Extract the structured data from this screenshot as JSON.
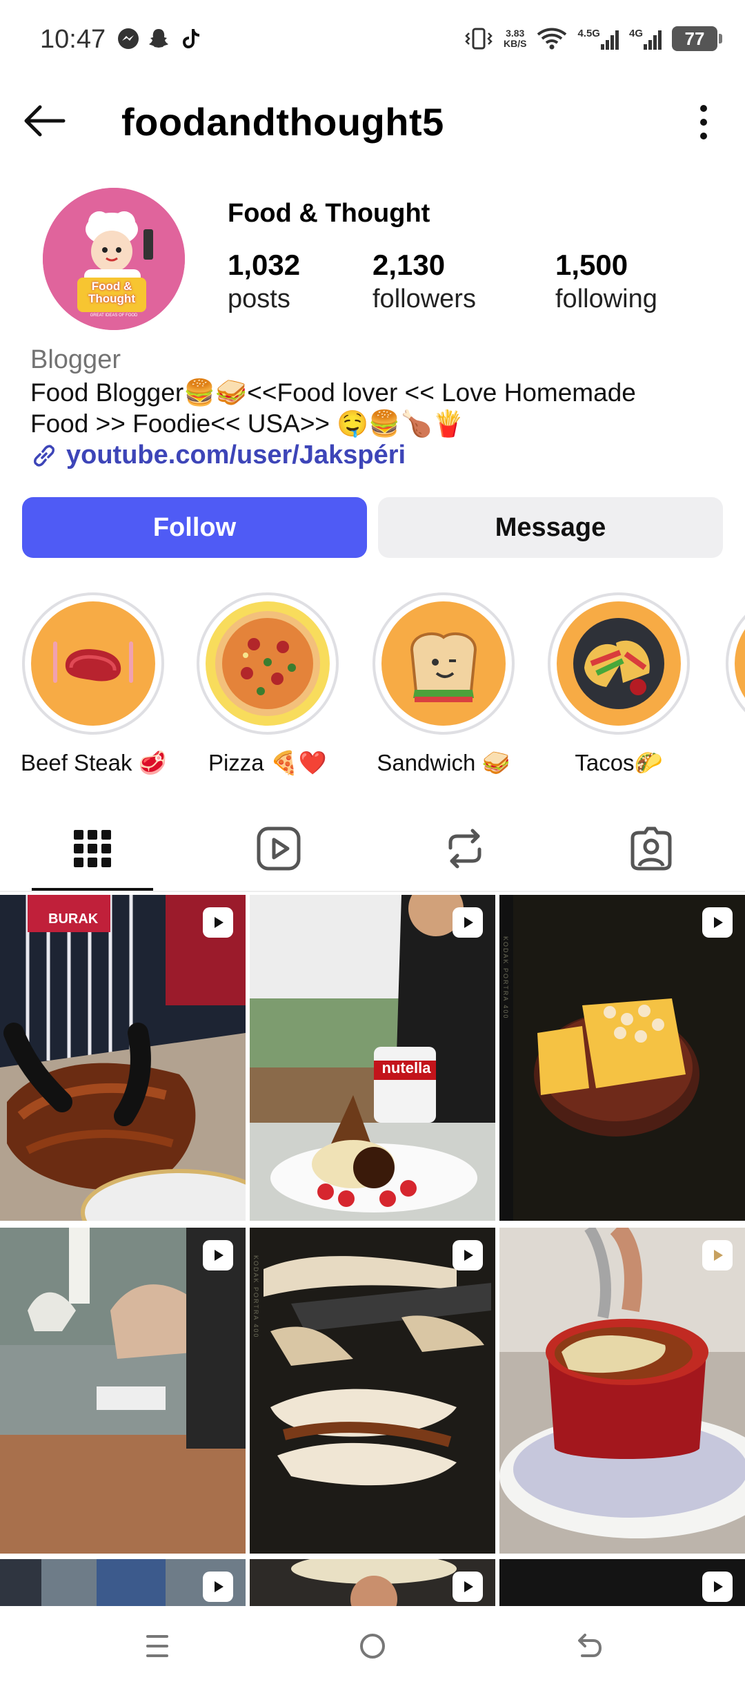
{
  "status_bar": {
    "time": "10:47",
    "speed_value": "3.83",
    "speed_unit": "KB/S",
    "net1": "4.5G",
    "net2": "4G",
    "battery": "77"
  },
  "header": {
    "username": "foodandthought5"
  },
  "profile": {
    "display_name": "Food & Thought",
    "avatar_text_1": "Food &",
    "avatar_text_2": "Thought",
    "avatar_tagline": "GREAT IDEAS OF FOOD",
    "stats": [
      {
        "value": "1,032",
        "label": "posts"
      },
      {
        "value": "2,130",
        "label": "followers"
      },
      {
        "value": "1,500",
        "label": "following"
      }
    ],
    "category": "Blogger",
    "bio_line1": "Food Blogger🍔🥪<<Food lover << Love Homemade",
    "bio_line2": "Food >> Foodie<< USA>> 🤤🍔🍗🍟",
    "link": "youtube.com/user/Jakspéri"
  },
  "actions": {
    "follow_label": "Follow",
    "message_label": "Message"
  },
  "highlights": [
    {
      "label": "Beef Steak 🥩",
      "icon": "steak-icon"
    },
    {
      "label": "Pizza 🍕❤️",
      "icon": "pizza-icon"
    },
    {
      "label": "Sandwich 🥪",
      "icon": "sandwich-icon"
    },
    {
      "label": "Tacos🌮",
      "icon": "tacos-icon"
    }
  ],
  "tabs": [
    "grid-icon",
    "reels-icon",
    "reposts-icon",
    "tagged-icon"
  ],
  "grid_badges": {
    "burak_sign": "BURAK",
    "nutella_label": "nutella",
    "film_edge_text": "KODAK PORTRA 400"
  },
  "colors": {
    "accent": "#4f5bf5",
    "link": "#3d45b8",
    "highlight_bg": "#f7ab45"
  }
}
